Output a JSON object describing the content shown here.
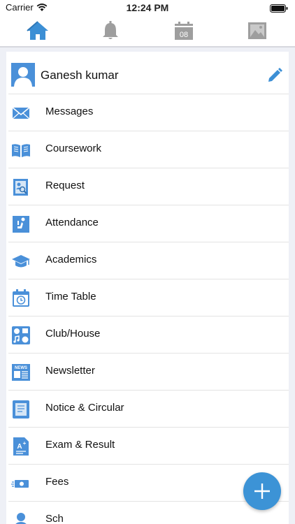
{
  "status_bar": {
    "carrier": "Carrier",
    "time": "12:24 PM"
  },
  "tabs": [
    {
      "name": "home",
      "icon": "home-icon"
    },
    {
      "name": "notifications",
      "icon": "bell-icon"
    },
    {
      "name": "calendar",
      "icon": "calendar-icon",
      "badge": "08"
    },
    {
      "name": "gallery",
      "icon": "image-icon"
    }
  ],
  "profile": {
    "name": "Ganesh kumar"
  },
  "menu": [
    {
      "label": "Messages",
      "icon": "envelope-icon"
    },
    {
      "label": "Coursework",
      "icon": "book-icon"
    },
    {
      "label": "Request",
      "icon": "request-icon"
    },
    {
      "label": "Attendance",
      "icon": "attendance-icon"
    },
    {
      "label": "Academics",
      "icon": "graduation-cap-icon"
    },
    {
      "label": "Time Table",
      "icon": "timetable-icon"
    },
    {
      "label": "Club/House",
      "icon": "club-icon"
    },
    {
      "label": "Newsletter",
      "icon": "newsletter-icon"
    },
    {
      "label": "Notice & Circular",
      "icon": "notice-icon"
    },
    {
      "label": "Exam & Result",
      "icon": "exam-icon"
    },
    {
      "label": "Fees",
      "icon": "fees-icon"
    },
    {
      "label": "Sch",
      "icon": "school-icon"
    }
  ],
  "colors": {
    "accent": "#3c93d6",
    "icon_blue": "#4a90d9",
    "tab_gray": "#9e9e9e"
  }
}
